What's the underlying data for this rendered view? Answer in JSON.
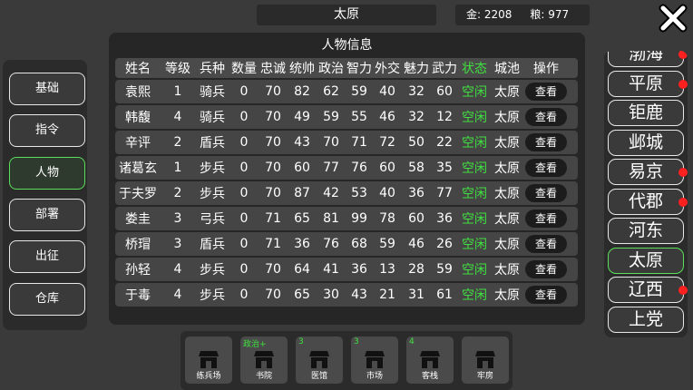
{
  "top": {
    "city": "太原",
    "gold": "金: 2208",
    "food": "粮: 977"
  },
  "menu": [
    {
      "label": "基础",
      "active": false
    },
    {
      "label": "指令",
      "active": false
    },
    {
      "label": "人物",
      "active": true
    },
    {
      "label": "部署",
      "active": false
    },
    {
      "label": "出征",
      "active": false
    },
    {
      "label": "仓库",
      "active": false
    }
  ],
  "panel": {
    "title": "人物信息",
    "headers": [
      "姓名",
      "等级",
      "兵种",
      "数量",
      "忠诚",
      "统帅",
      "政治",
      "智力",
      "外交",
      "魅力",
      "武力",
      "状态",
      "城池",
      "操作"
    ],
    "rows": [
      [
        "袁熙",
        "1",
        "骑兵",
        "0",
        "70",
        "82",
        "62",
        "59",
        "40",
        "32",
        "60",
        "空闲",
        "太原",
        "查看"
      ],
      [
        "韩馥",
        "4",
        "骑兵",
        "0",
        "70",
        "49",
        "59",
        "55",
        "46",
        "32",
        "12",
        "空闲",
        "太原",
        "查看"
      ],
      [
        "辛评",
        "2",
        "盾兵",
        "0",
        "70",
        "43",
        "70",
        "71",
        "72",
        "50",
        "22",
        "空闲",
        "太原",
        "查看"
      ],
      [
        "诸葛玄",
        "1",
        "步兵",
        "0",
        "70",
        "60",
        "77",
        "76",
        "60",
        "58",
        "35",
        "空闲",
        "太原",
        "查看"
      ],
      [
        "于夫罗",
        "2",
        "步兵",
        "0",
        "70",
        "87",
        "42",
        "53",
        "40",
        "36",
        "77",
        "空闲",
        "太原",
        "查看"
      ],
      [
        "娄圭",
        "3",
        "弓兵",
        "0",
        "71",
        "65",
        "81",
        "99",
        "78",
        "60",
        "36",
        "空闲",
        "太原",
        "查看"
      ],
      [
        "桥瑁",
        "3",
        "盾兵",
        "0",
        "71",
        "36",
        "76",
        "68",
        "59",
        "46",
        "26",
        "空闲",
        "太原",
        "查看"
      ],
      [
        "孙轻",
        "4",
        "步兵",
        "0",
        "70",
        "64",
        "41",
        "36",
        "13",
        "28",
        "59",
        "空闲",
        "太原",
        "查看"
      ],
      [
        "于毒",
        "4",
        "步兵",
        "0",
        "70",
        "65",
        "30",
        "43",
        "21",
        "31",
        "61",
        "空闲",
        "太原",
        "查看"
      ]
    ]
  },
  "cities": [
    {
      "name": "渤海",
      "dot": true,
      "active": false
    },
    {
      "name": "平原",
      "dot": true,
      "active": false
    },
    {
      "name": "钜鹿",
      "dot": false,
      "active": false
    },
    {
      "name": "邺城",
      "dot": false,
      "active": false
    },
    {
      "name": "易京",
      "dot": true,
      "active": false
    },
    {
      "name": "代郡",
      "dot": true,
      "active": false
    },
    {
      "name": "河东",
      "dot": false,
      "active": false
    },
    {
      "name": "太原",
      "dot": false,
      "active": true
    },
    {
      "name": "辽西",
      "dot": true,
      "active": false
    },
    {
      "name": "上党",
      "dot": false,
      "active": false
    }
  ],
  "buildings": [
    {
      "name": "练兵场",
      "badge": ""
    },
    {
      "name": "书院",
      "badge": "政治+"
    },
    {
      "name": "医馆",
      "badge": "3"
    },
    {
      "name": "市场",
      "badge": "3"
    },
    {
      "name": "客栈",
      "badge": "4"
    },
    {
      "name": "牢房",
      "badge": ""
    }
  ],
  "colors": {
    "accent": "#3fe03f",
    "alert": "#ff2020"
  }
}
